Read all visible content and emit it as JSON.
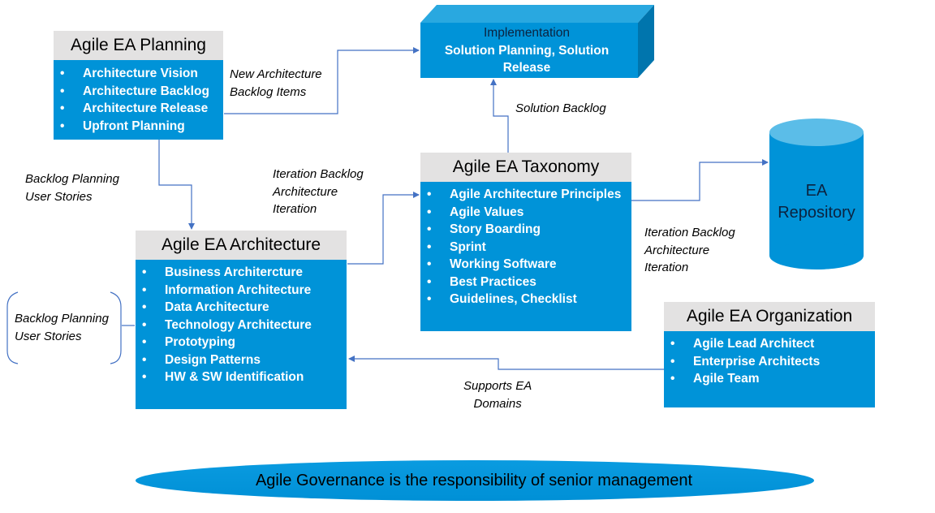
{
  "colors": {
    "box_blue": "#0093d8",
    "header_gray": "#e3e2e2",
    "connector": "#4472c4",
    "cube_top": "#29a8e0",
    "cube_side": "#0075ad",
    "cylinder_top": "#5bbde8"
  },
  "planning": {
    "title": "Agile EA Planning",
    "items": [
      "Architecture Vision",
      "Architecture Backlog",
      "Architecture Release",
      "Upfront Planning"
    ]
  },
  "implementation": {
    "line1": "Implementation",
    "line2": "Solution Planning, Solution",
    "line3": "Release"
  },
  "taxonomy": {
    "title": "Agile EA Taxonomy",
    "items": [
      "Agile Architecture Principles",
      "Agile Values",
      "Story Boarding",
      "Sprint",
      "Working Software",
      "Best Practices",
      "Guidelines, Checklist"
    ]
  },
  "architecture": {
    "title": "Agile EA Architecture",
    "items": [
      "Business Architercture",
      "Information Architecture",
      "Data Architecture",
      "Technology Architecture",
      "Prototyping",
      "Design Patterns",
      "HW & SW Identification"
    ]
  },
  "organization": {
    "title": "Agile EA Organization",
    "items": [
      "Agile Lead Architect",
      "Enterprise Architects",
      "Agile Team"
    ]
  },
  "repository": {
    "line1": "EA",
    "line2": "Repository"
  },
  "labels": {
    "new_backlog": [
      "New Architecture",
      "Backlog Items"
    ],
    "solution_backlog": "Solution Backlog",
    "backlog_planning_top": [
      "Backlog Planning",
      "User Stories"
    ],
    "backlog_planning_side": [
      "Backlog Planning",
      "User Stories"
    ],
    "iteration_left": [
      "Iteration Backlog",
      "Architecture",
      "Iteration"
    ],
    "iteration_right": [
      "Iteration Backlog",
      "Architecture",
      "Iteration"
    ],
    "supports": [
      "Supports EA",
      "Domains"
    ]
  },
  "bullet": "•",
  "governance": "Agile Governance is the responsibility of senior management"
}
